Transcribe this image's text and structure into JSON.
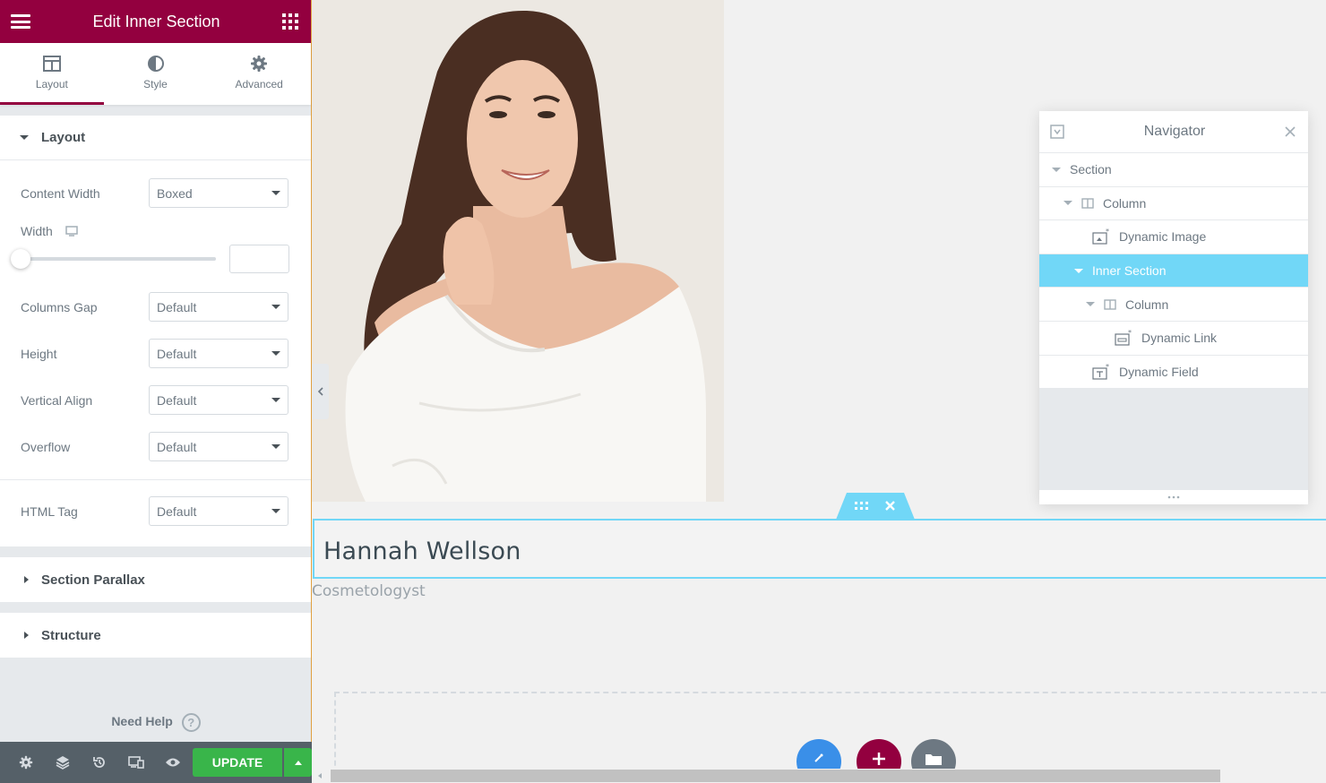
{
  "panel": {
    "title": "Edit Inner Section",
    "tabs": [
      {
        "label": "Layout",
        "active": true
      },
      {
        "label": "Style",
        "active": false
      },
      {
        "label": "Advanced",
        "active": false
      }
    ],
    "layout_section": {
      "title": "Layout",
      "content_width": {
        "label": "Content Width",
        "value": "Boxed"
      },
      "width": {
        "label": "Width",
        "value": ""
      },
      "columns_gap": {
        "label": "Columns Gap",
        "value": "Default"
      },
      "height": {
        "label": "Height",
        "value": "Default"
      },
      "vertical_align": {
        "label": "Vertical Align",
        "value": "Default"
      },
      "overflow": {
        "label": "Overflow",
        "value": "Default"
      },
      "html_tag": {
        "label": "HTML Tag",
        "value": "Default"
      }
    },
    "section_parallax": "Section Parallax",
    "structure": "Structure",
    "need_help": "Need Help",
    "help_icon_glyph": "?",
    "update_label": "UPDATE"
  },
  "canvas": {
    "name": "Hannah Wellson",
    "role": "Cosmetologyst"
  },
  "navigator": {
    "title": "Navigator",
    "items": [
      {
        "label": "Section",
        "icon": "caret"
      },
      {
        "label": "Column",
        "icon": "column-icon"
      },
      {
        "label": "Dynamic Image",
        "icon": "dynamic-image-icon"
      },
      {
        "label": "Inner Section",
        "icon": "caret",
        "selected": true
      },
      {
        "label": "Column",
        "icon": "column-icon"
      },
      {
        "label": "Dynamic Link",
        "icon": "dynamic-link-icon"
      },
      {
        "label": "Dynamic Field",
        "icon": "dynamic-field-icon"
      }
    ]
  },
  "colors": {
    "brand": "#93003f",
    "update_green": "#39b54a",
    "selection": "#71d7f7",
    "footer": "#556068"
  }
}
